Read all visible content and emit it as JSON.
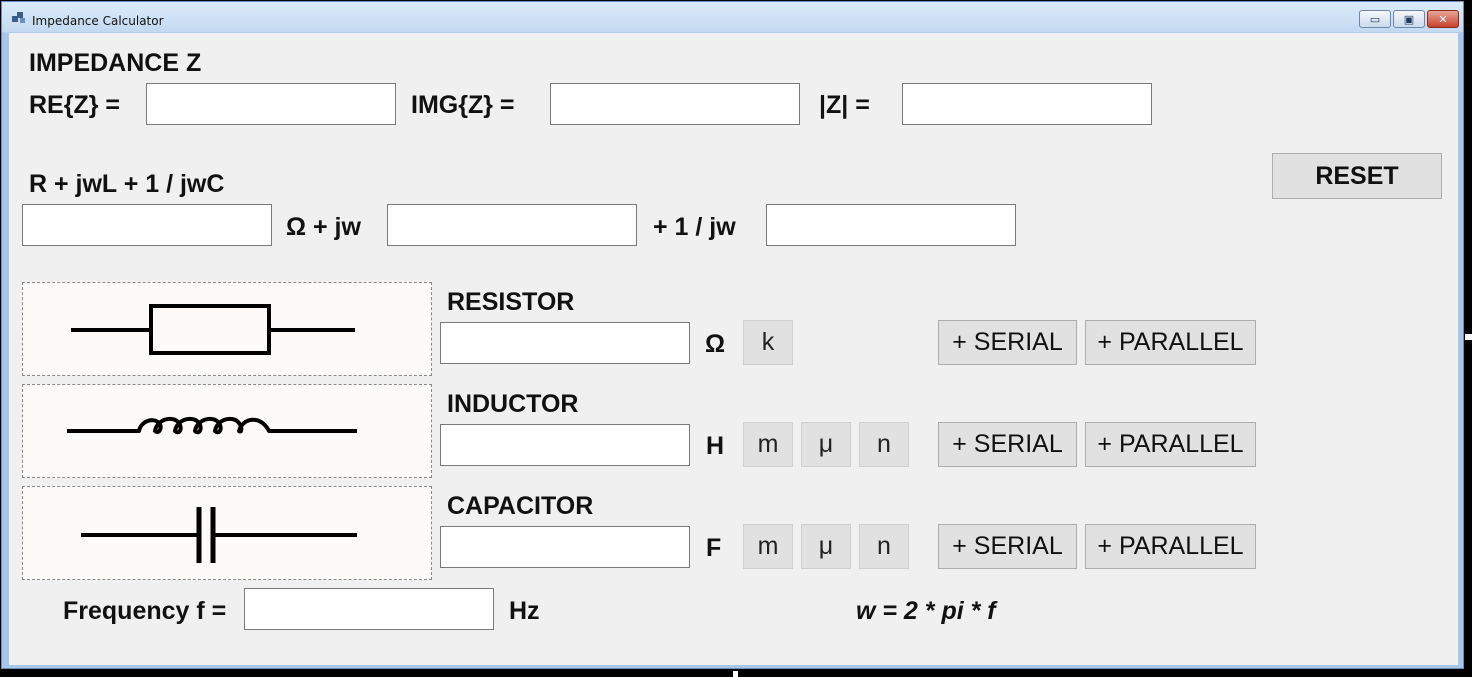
{
  "window": {
    "title": "Impedance Calculator",
    "controls": {
      "minimize": "▭",
      "maximize": "▣",
      "close": "✕"
    }
  },
  "impedance": {
    "heading": "IMPEDANCE Z",
    "re_label": "RE{Z} =",
    "re_value": "",
    "img_label": "IMG{Z} =",
    "img_value": "",
    "abs_label": "|Z| =",
    "abs_value": ""
  },
  "formula_row": {
    "heading": "R + jwL + 1 / jwC",
    "r_value": "",
    "omega_jw_label": "Ω + jw",
    "l_value": "",
    "inv_jw_label": "+ 1 / jw",
    "c_value": ""
  },
  "reset_label": "RESET",
  "resistor": {
    "heading": "RESISTOR",
    "value": "",
    "unit": "Ω",
    "prefixes": [
      "k"
    ],
    "serial_label": "+ SERIAL",
    "parallel_label": "+ PARALLEL"
  },
  "inductor": {
    "heading": "INDUCTOR",
    "value": "",
    "unit": "H",
    "prefixes": [
      "m",
      "μ",
      "n"
    ],
    "serial_label": "+ SERIAL",
    "parallel_label": "+ PARALLEL"
  },
  "capacitor": {
    "heading": "CAPACITOR",
    "value": "",
    "unit": "F",
    "prefixes": [
      "m",
      "μ",
      "n"
    ],
    "serial_label": "+ SERIAL",
    "parallel_label": "+ PARALLEL"
  },
  "frequency": {
    "label": "Frequency f =",
    "value": "",
    "unit": "Hz"
  },
  "omega_formula": "w = 2 * pi * f"
}
